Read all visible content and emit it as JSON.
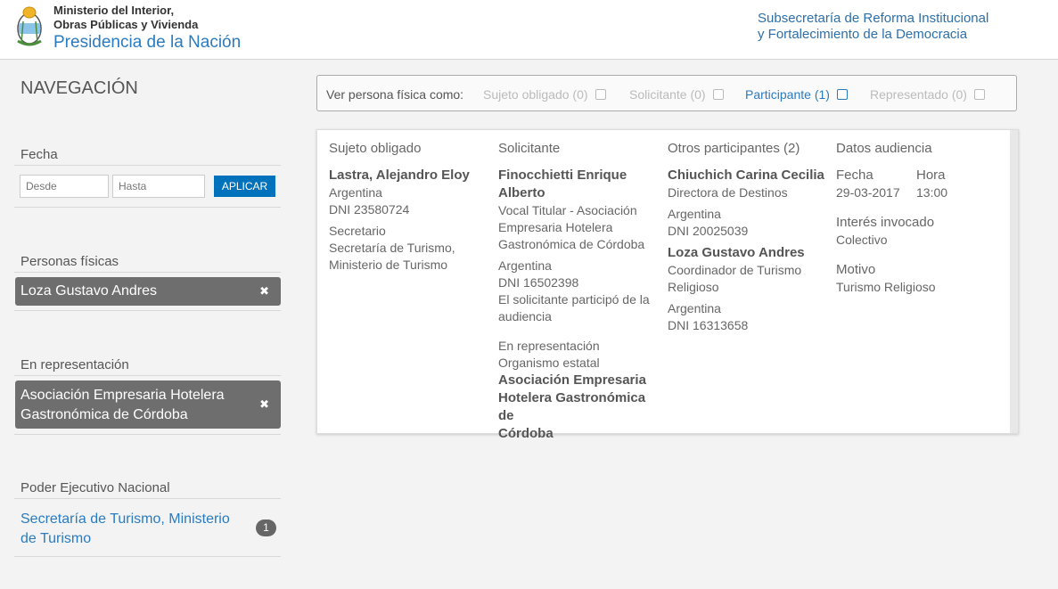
{
  "header": {
    "ministry_line1": "Ministerio del Interior,",
    "ministry_line2": "Obras Públicas y Vivienda",
    "ministry_line3": "Presidencia de la Nación",
    "subsec_line1": "Subsecretaría de Reforma Institucional",
    "subsec_line2": "y Fortalecimiento de la Democracia",
    "logo_icon": "coat-of-arms-icon"
  },
  "sidebar": {
    "title": "NAVEGACIÓN",
    "fecha": {
      "title": "Fecha",
      "desde_placeholder": "Desde",
      "hasta_placeholder": "Hasta",
      "apply_label": "APLICAR"
    },
    "personas": {
      "title": "Personas físicas",
      "chip": "Loza Gustavo Andres",
      "remove_icon": "✖"
    },
    "representacion": {
      "title": "En representación",
      "chip": "Asociación Empresaria Hotelera Gastronómica de Córdoba",
      "remove_icon": "✖"
    },
    "poder": {
      "title": "Poder Ejecutivo Nacional",
      "item": "Secretaría de Turismo, Ministerio de Turismo",
      "count": "1"
    }
  },
  "filter": {
    "label": "Ver persona física como:",
    "options": [
      {
        "label": "Sujeto obligado (0)",
        "active": false
      },
      {
        "label": "Solicitante (0)",
        "active": false
      },
      {
        "label": "Participante (1)",
        "active": true
      },
      {
        "label": "Representado (0)",
        "active": false
      }
    ]
  },
  "card": {
    "sujeto": {
      "heading": "Sujeto obligado",
      "name": "Lastra, Alejandro Eloy",
      "country": "Argentina",
      "dni": "DNI 23580724",
      "role": "Secretario",
      "org_line1": "Secretaría de Turismo,",
      "org_line2": "Ministerio de Turismo"
    },
    "solicitante": {
      "heading": "Solicitante",
      "name_line1": "Finocchietti Enrique",
      "name_line2": "Alberto",
      "role_line1": "Vocal Titular - Asociación",
      "role_line2": "Empresaria Hotelera",
      "role_line3": "Gastronómica de Córdoba",
      "country": "Argentina",
      "dni": "DNI 16502398",
      "note_line1": "El solicitante participó de la",
      "note_line2": "audiencia",
      "rep_label": "En representación",
      "rep_type": "Organismo estatal",
      "rep_org_line1": "Asociación Empresaria",
      "rep_org_line2": "Hotelera Gastronómica de",
      "rep_org_line3": "Córdoba"
    },
    "otros": {
      "heading": "Otros participantes (2)",
      "p1_name": "Chiuchich Carina Cecilia",
      "p1_role": "Directora de Destinos",
      "p1_country": "Argentina",
      "p1_dni": "DNI 20025039",
      "p2_name": "Loza Gustavo Andres",
      "p2_role_line1": "Coordinador de Turismo",
      "p2_role_line2": "Religioso",
      "p2_country": "Argentina",
      "p2_dni": "DNI 16313658"
    },
    "audiencia": {
      "heading": "Datos audiencia",
      "fecha_label": "Fecha",
      "fecha_value": "29-03-2017",
      "hora_label": "Hora",
      "hora_value": "13:00",
      "interes_label": "Interés invocado",
      "interes_value": "Colectivo",
      "motivo_label": "Motivo",
      "motivo_value": "Turismo Religioso"
    }
  }
}
